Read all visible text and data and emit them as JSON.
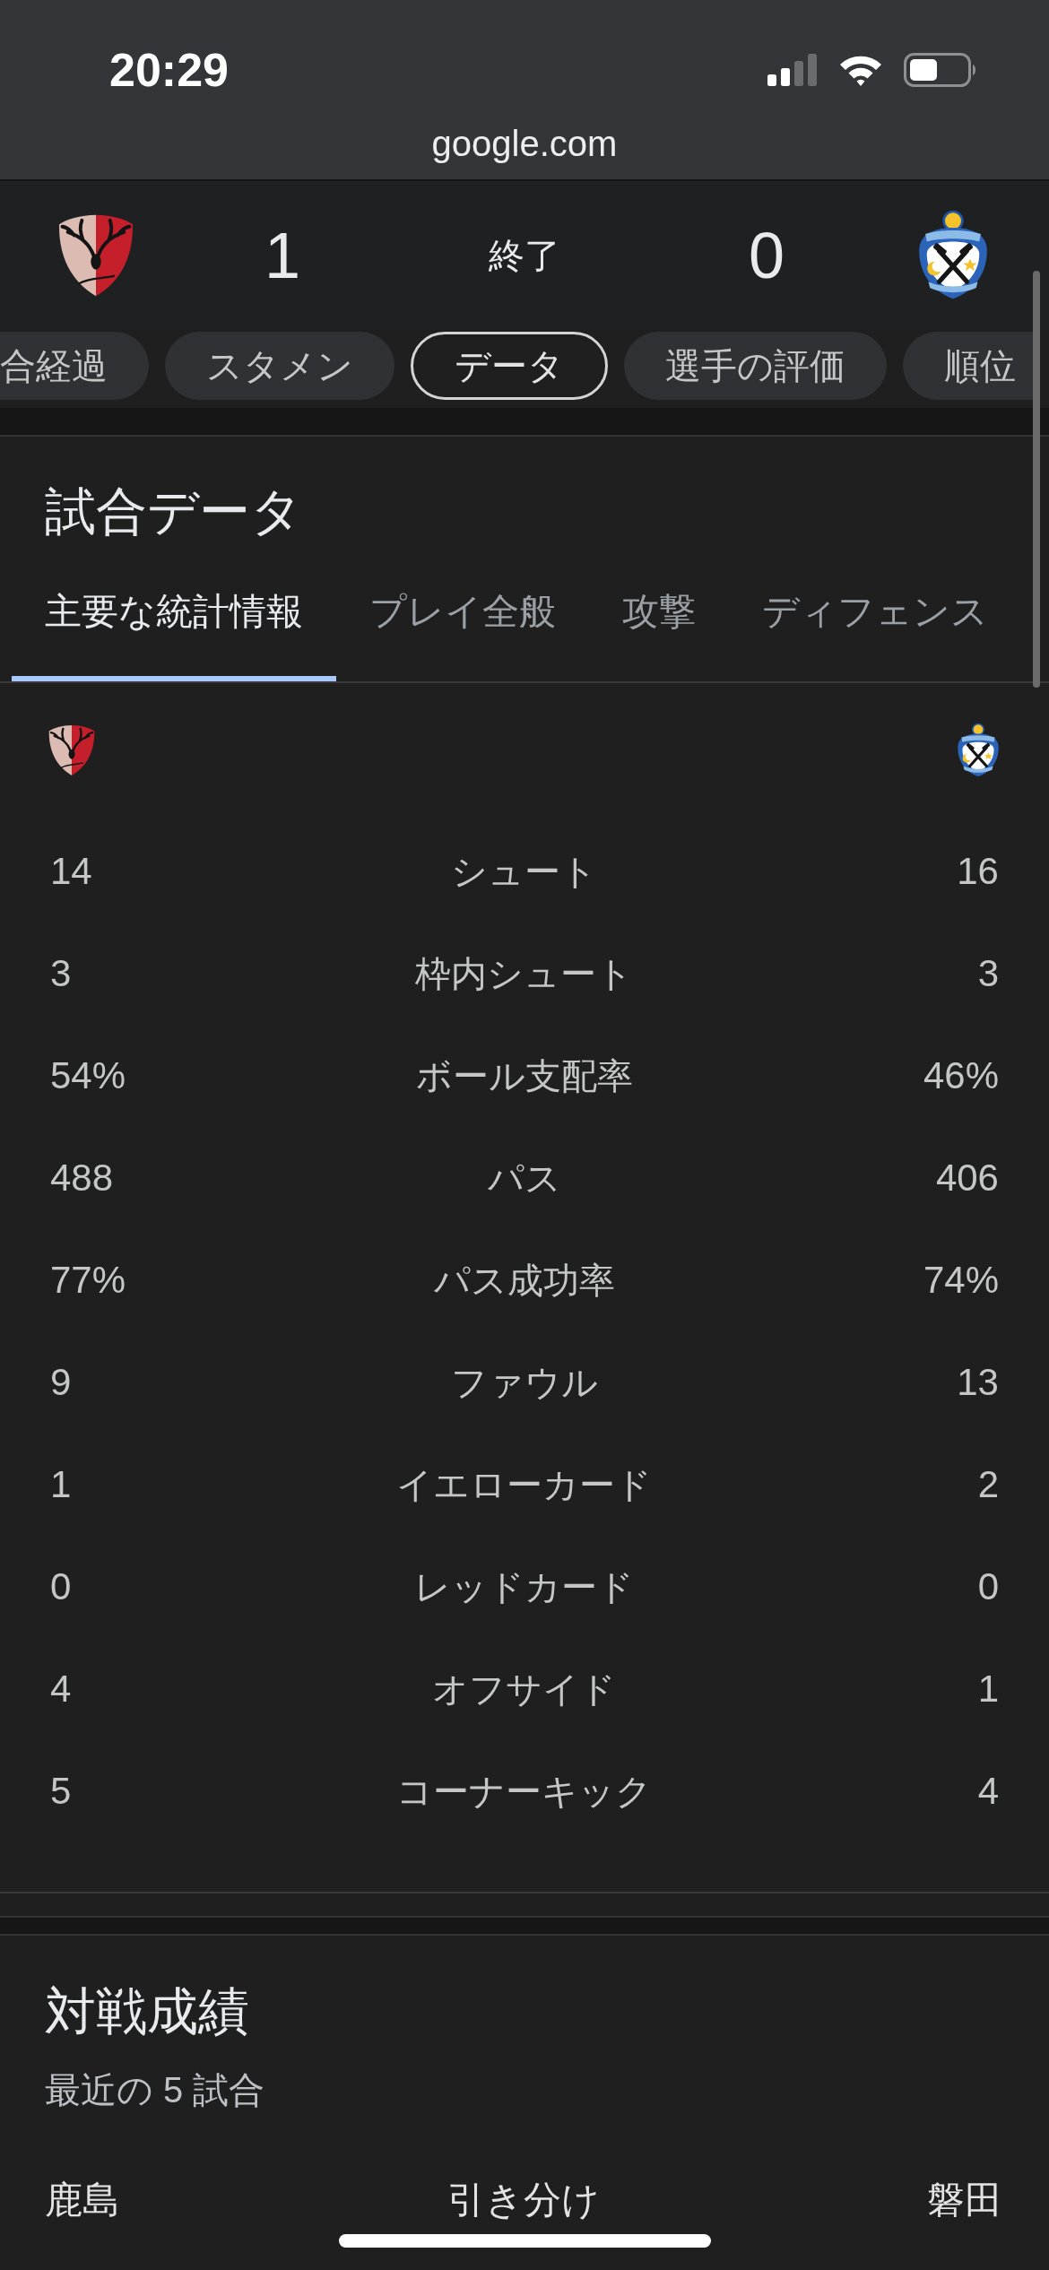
{
  "status_bar": {
    "time": "20:29"
  },
  "browser": {
    "url": "google.com"
  },
  "scoreboard": {
    "home_score": "1",
    "status": "終了",
    "away_score": "0"
  },
  "chips": [
    {
      "label": "合経過",
      "selected": false
    },
    {
      "label": "スタメン",
      "selected": false
    },
    {
      "label": "データ",
      "selected": true
    },
    {
      "label": "選手の評価",
      "selected": false
    },
    {
      "label": "順位",
      "selected": false
    }
  ],
  "match_stats": {
    "title": "試合データ",
    "tabs": [
      {
        "label": "主要な統計情報",
        "selected": true
      },
      {
        "label": "プレイ全般",
        "selected": false
      },
      {
        "label": "攻撃",
        "selected": false
      },
      {
        "label": "ディフェンス",
        "selected": false
      }
    ],
    "rows": [
      {
        "home": "14",
        "label": "シュート",
        "away": "16"
      },
      {
        "home": "3",
        "label": "枠内シュート",
        "away": "3"
      },
      {
        "home": "54%",
        "label": "ボール支配率",
        "away": "46%"
      },
      {
        "home": "488",
        "label": "パス",
        "away": "406"
      },
      {
        "home": "77%",
        "label": "パス成功率",
        "away": "74%"
      },
      {
        "home": "9",
        "label": "ファウル",
        "away": "13"
      },
      {
        "home": "1",
        "label": "イエローカード",
        "away": "2"
      },
      {
        "home": "0",
        "label": "レッドカード",
        "away": "0"
      },
      {
        "home": "4",
        "label": "オフサイド",
        "away": "1"
      },
      {
        "home": "5",
        "label": "コーナーキック",
        "away": "4"
      }
    ]
  },
  "head_to_head": {
    "title": "対戦成績",
    "subtitle": "最近の 5 試合",
    "home_team": "鹿島",
    "draws_label": "引き分け",
    "away_team": "磐田"
  }
}
